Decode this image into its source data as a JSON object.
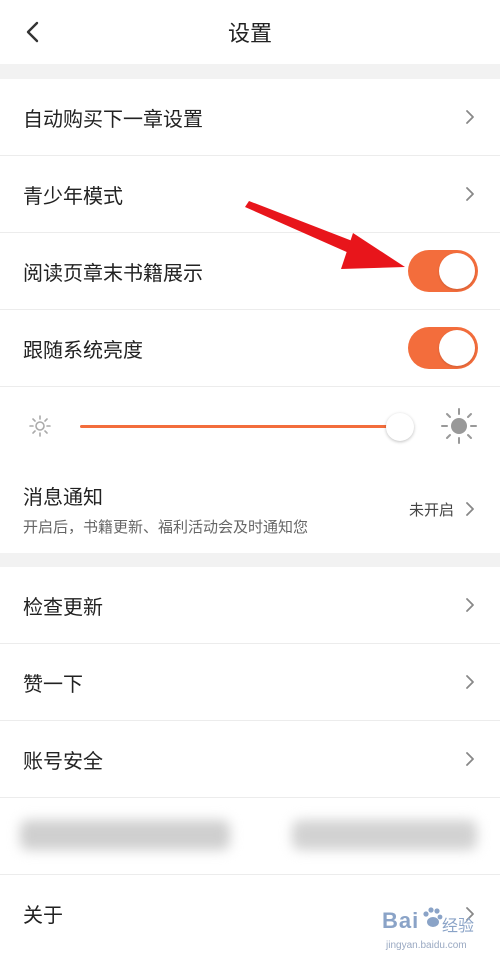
{
  "header": {
    "title": "设置"
  },
  "group1": {
    "items": [
      {
        "label": "自动购买下一章设置",
        "type": "chevron"
      },
      {
        "label": "青少年模式",
        "type": "chevron"
      },
      {
        "label": "阅读页章末书籍展示",
        "type": "toggle",
        "on": true
      },
      {
        "label": "跟随系统亮度",
        "type": "toggle",
        "on": true
      }
    ],
    "brightness": {
      "level": 0.97
    }
  },
  "notify": {
    "title": "消息通知",
    "subtitle": "开启后，书籍更新、福利活动会及时通知您",
    "status": "未开启"
  },
  "group3": {
    "items": [
      {
        "label": "检查更新"
      },
      {
        "label": "赞一下"
      },
      {
        "label": "账号安全"
      },
      {
        "label": "关于"
      }
    ]
  },
  "watermark": {
    "brand": "Bai",
    "cn": "经验",
    "url": "jingyan.baidu.com"
  },
  "colors": {
    "accent": "#f36d3c",
    "arrow": "#e8151b",
    "background": "#f2f2f2"
  }
}
